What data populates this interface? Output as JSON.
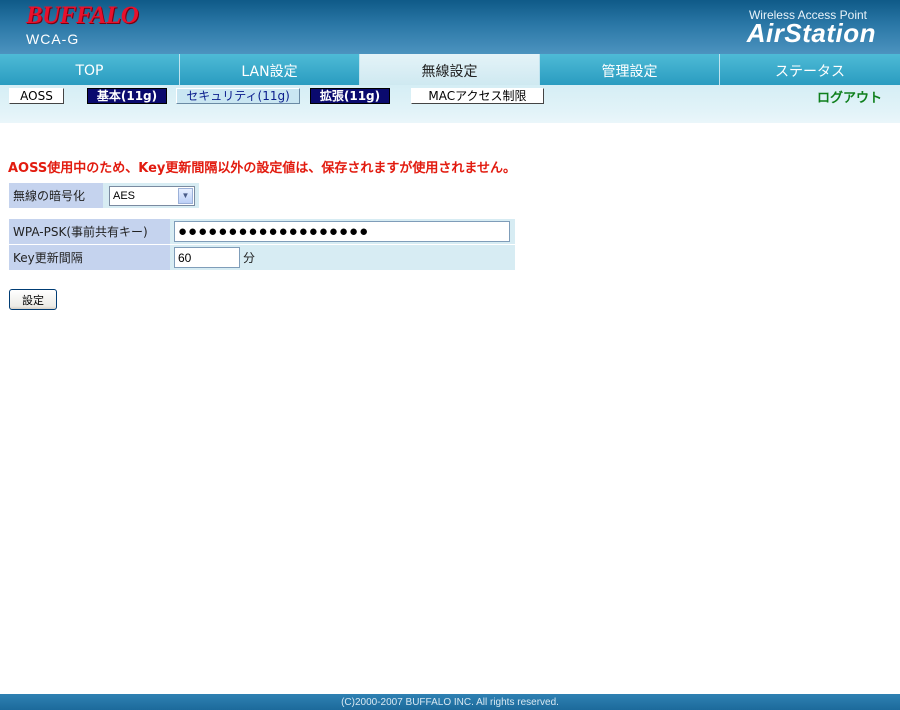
{
  "header": {
    "logo": "BUFFALO",
    "model": "WCA-G",
    "product_subtitle": "Wireless Access Point",
    "product_name": "AirStation"
  },
  "main_nav": {
    "tabs": [
      {
        "label": "TOP",
        "active": false
      },
      {
        "label": "LAN設定",
        "active": false
      },
      {
        "label": "無線設定",
        "active": true
      },
      {
        "label": "管理設定",
        "active": false
      },
      {
        "label": "ステータス",
        "active": false
      }
    ]
  },
  "sub_nav": {
    "items": [
      {
        "label": "AOSS",
        "style": "plain"
      },
      {
        "label": "基本(11g)",
        "style": "dark"
      },
      {
        "label": "セキュリティ(11g)",
        "style": "selected"
      },
      {
        "label": "拡張(11g)",
        "style": "dark"
      },
      {
        "label": "MACアクセス制限",
        "style": "plain"
      }
    ],
    "logout": "ログアウト"
  },
  "content": {
    "warning": "AOSS使用中のため、Key更新間隔以外の設定値は、保存されますが使用されません。",
    "encryption": {
      "label": "無線の暗号化",
      "value": "AES"
    },
    "wpa_psk": {
      "label": "WPA-PSK(事前共有キー)",
      "masked_value": "●●●●●●●●●●●●●●●●●●●"
    },
    "key_interval": {
      "label": "Key更新間隔",
      "value": "60",
      "unit": "分"
    },
    "submit_label": "設定"
  },
  "footer": {
    "copyright": "(C)2000-2007 BUFFALO INC. All rights reserved."
  }
}
